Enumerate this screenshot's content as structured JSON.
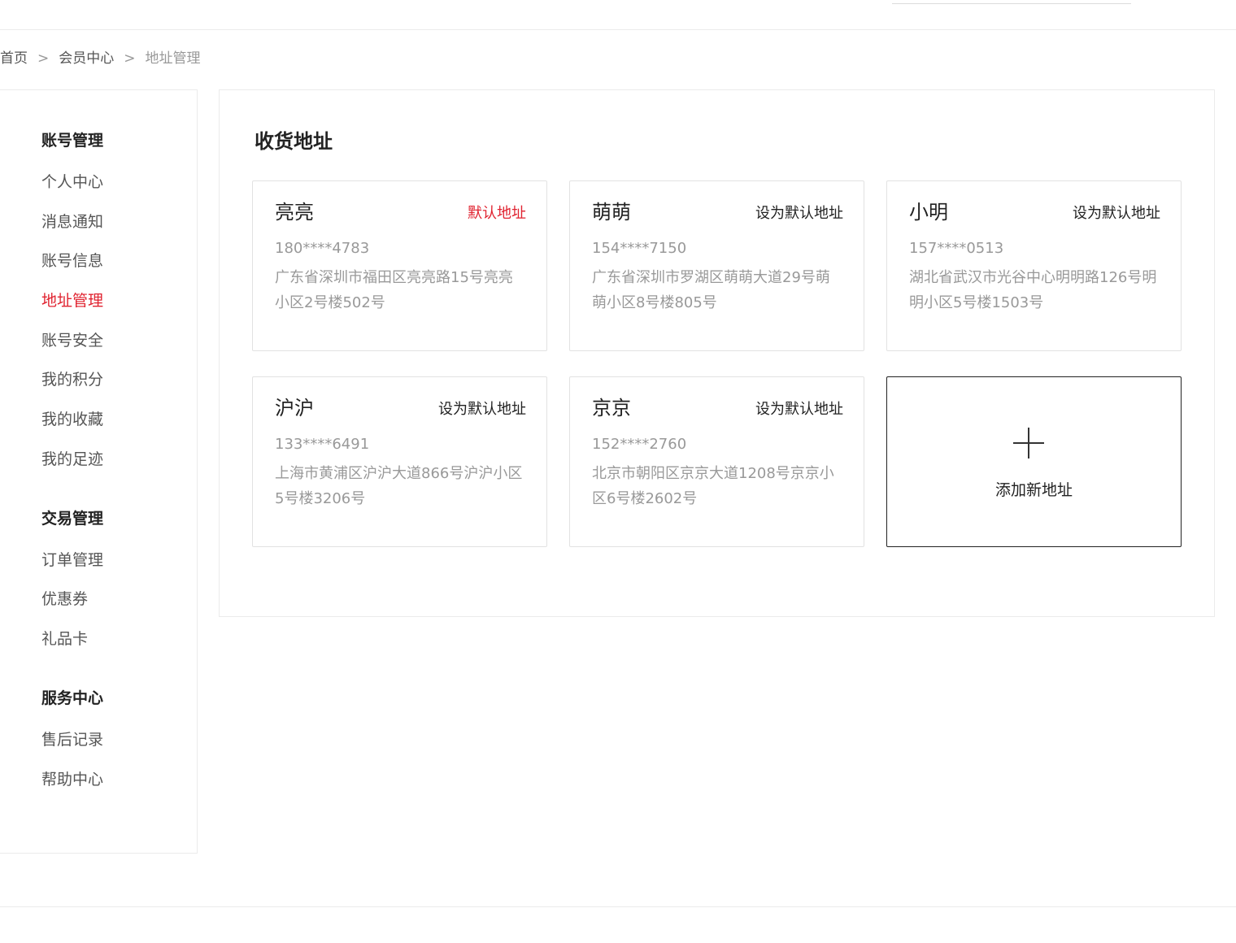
{
  "breadcrumb": {
    "items": [
      "首页",
      "会员中心",
      "地址管理"
    ],
    "separator": ">"
  },
  "sidebar": {
    "groups": [
      {
        "title": "账号管理",
        "items": [
          "个人中心",
          "消息通知",
          "账号信息",
          "地址管理",
          "账号安全",
          "我的积分",
          "我的收藏",
          "我的足迹"
        ]
      },
      {
        "title": "交易管理",
        "items": [
          "订单管理",
          "优惠券",
          "礼品卡"
        ]
      },
      {
        "title": "服务中心",
        "items": [
          "售后记录",
          "帮助中心"
        ]
      }
    ],
    "active_item": "地址管理"
  },
  "main": {
    "title": "收货地址",
    "addresses": [
      {
        "name": "亮亮",
        "action": "默认地址",
        "phone": "180****4783",
        "address": "广东省深圳市福田区亮亮路15号亮亮小区2号楼502号"
      },
      {
        "name": "萌萌",
        "action": "设为默认地址",
        "phone": "154****7150",
        "address": "广东省深圳市罗湖区萌萌大道29号萌萌小区8号楼805号"
      },
      {
        "name": "小明",
        "action": "设为默认地址",
        "phone": "157****0513",
        "address": "湖北省武汉市光谷中心明明路126号明明小区5号楼1503号"
      },
      {
        "name": "沪沪",
        "action": "设为默认地址",
        "phone": "133****6491",
        "address": "上海市黄浦区沪沪大道866号沪沪小区5号楼3206号"
      },
      {
        "name": "京京",
        "action": "设为默认地址",
        "phone": "152****2760",
        "address": "北京市朝阳区京京大道1208号京京小区6号楼2602号"
      }
    ],
    "add_card": {
      "label": "添加新地址",
      "icon": "plus-icon"
    }
  },
  "colors": {
    "accent": "#e0222f",
    "text": "#222222",
    "muted": "#999999",
    "border": "#ebebeb"
  }
}
